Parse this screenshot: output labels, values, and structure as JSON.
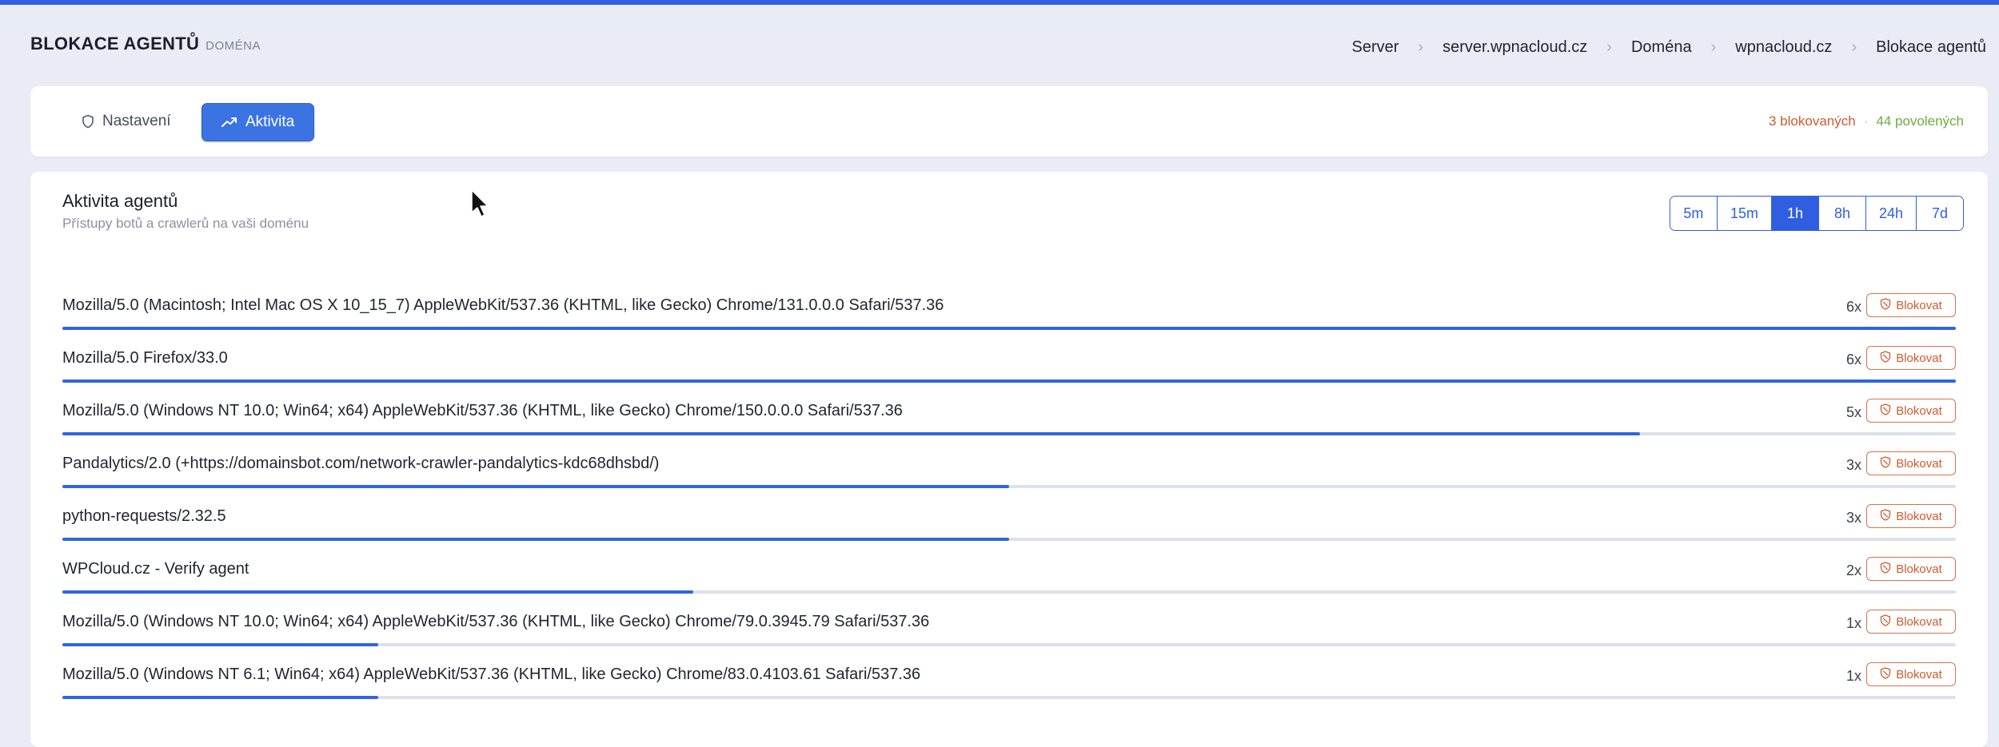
{
  "page": {
    "title": "BLOKACE AGENTŮ",
    "subtitle": "DOMÉNA"
  },
  "breadcrumb": [
    "Server",
    "server.wpnacloud.cz",
    "Doména",
    "wpnacloud.cz",
    "Blokace agentů"
  ],
  "tabs": {
    "settings_label": "Nastavení",
    "activity_label": "Aktivita",
    "active": "activity"
  },
  "counts": {
    "blocked": "3 blokovaných",
    "separator": "·",
    "allowed": "44 povolených"
  },
  "activity": {
    "title": "Aktivita agentů",
    "subtitle": "Přístupy botů a crawlerů na vaši doménu",
    "ranges": [
      "5m",
      "15m",
      "1h",
      "8h",
      "24h",
      "7d"
    ],
    "selected_range": "1h",
    "block_label": "Blokovat",
    "max_count": 6,
    "agents": [
      {
        "ua": "Mozilla/5.0 (Macintosh; Intel Mac OS X 10_15_7) AppleWebKit/537.36 (KHTML, like Gecko) Chrome/131.0.0.0 Safari/537.36",
        "count": 6,
        "count_label": "6x"
      },
      {
        "ua": "Mozilla/5.0 Firefox/33.0",
        "count": 6,
        "count_label": "6x"
      },
      {
        "ua": "Mozilla/5.0 (Windows NT 10.0; Win64; x64) AppleWebKit/537.36 (KHTML, like Gecko) Chrome/150.0.0.0 Safari/537.36",
        "count": 5,
        "count_label": "5x"
      },
      {
        "ua": "Pandalytics/2.0 (+https://domainsbot.com/network-crawler-pandalytics-kdc68dhsbd/)",
        "count": 3,
        "count_label": "3x"
      },
      {
        "ua": "python-requests/2.32.5",
        "count": 3,
        "count_label": "3x"
      },
      {
        "ua": "WPCloud.cz - Verify agent",
        "count": 2,
        "count_label": "2x"
      },
      {
        "ua": "Mozilla/5.0 (Windows NT 10.0; Win64; x64) AppleWebKit/537.36 (KHTML, like Gecko) Chrome/79.0.3945.79 Safari/537.36",
        "count": 1,
        "count_label": "1x"
      },
      {
        "ua": "Mozilla/5.0 (Windows NT 6.1; Win64; x64) AppleWebKit/537.36 (KHTML, like Gecko) Chrome/83.0.4103.61 Safari/537.36",
        "count": 1,
        "count_label": "1x"
      }
    ]
  },
  "colors": {
    "accent": "#2f5fe0",
    "blocked": "#cf5a2e",
    "allowed": "#6cac3e"
  },
  "icons": {
    "settings_tab": "shield-icon",
    "activity_tab": "trend-line-icon",
    "block_button": "block-shield-icon",
    "breadcrumb_separator": "chevron-right-icon"
  }
}
